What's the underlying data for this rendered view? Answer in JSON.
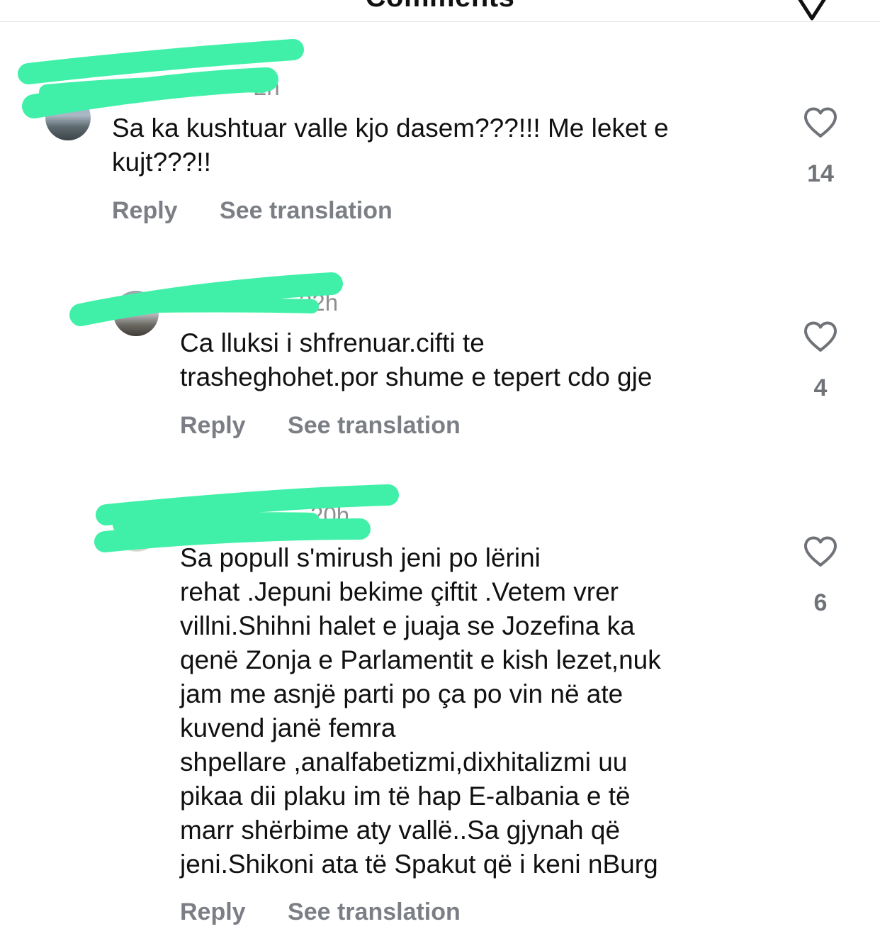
{
  "header": {
    "title": "Comments",
    "filter_icon": "filter-icon"
  },
  "comments": [
    {
      "username": "",
      "time": "2h",
      "lines": [
        "Sa ka kushtuar valle kjo dasem???!!! Me leket e",
        "kujt???!!"
      ],
      "reply_label": "Reply",
      "translate_label": "See translation",
      "likes": "14"
    },
    {
      "username": "",
      "time": "22h",
      "lines": [
        "Ca lluksi i shfrenuar.cifti te",
        "trasheghohet.por shume e tepert cdo gje"
      ],
      "reply_label": "Reply",
      "translate_label": "See translation",
      "likes": "4"
    },
    {
      "username": "",
      "time": "20h",
      "lines": [
        "Sa popull s'mirush jeni po lërini",
        "rehat .Jepuni bekime çiftit .Vetem vrer",
        "villni.Shihni halet e juaja se Jozefina ka",
        "qenë Zonja e Parlamentit e kish lezet,nuk",
        "jam me asnjë parti po ça po vin në ate",
        "kuvend janë femra",
        "shpellare ,analfabetizmi,dixhitalizmi uu",
        "pikaa dii plaku im të hap E-albania e të",
        "marr shërbime aty vallë..Sa gjynah që",
        "jeni.Shikoni ata të Spakut që i keni nBurg"
      ],
      "reply_label": "Reply",
      "translate_label": "See translation",
      "likes": "6"
    }
  ],
  "colors": {
    "redaction": "#41f0a8",
    "muted": "#8e8e8e",
    "action": "#7b7f85"
  }
}
